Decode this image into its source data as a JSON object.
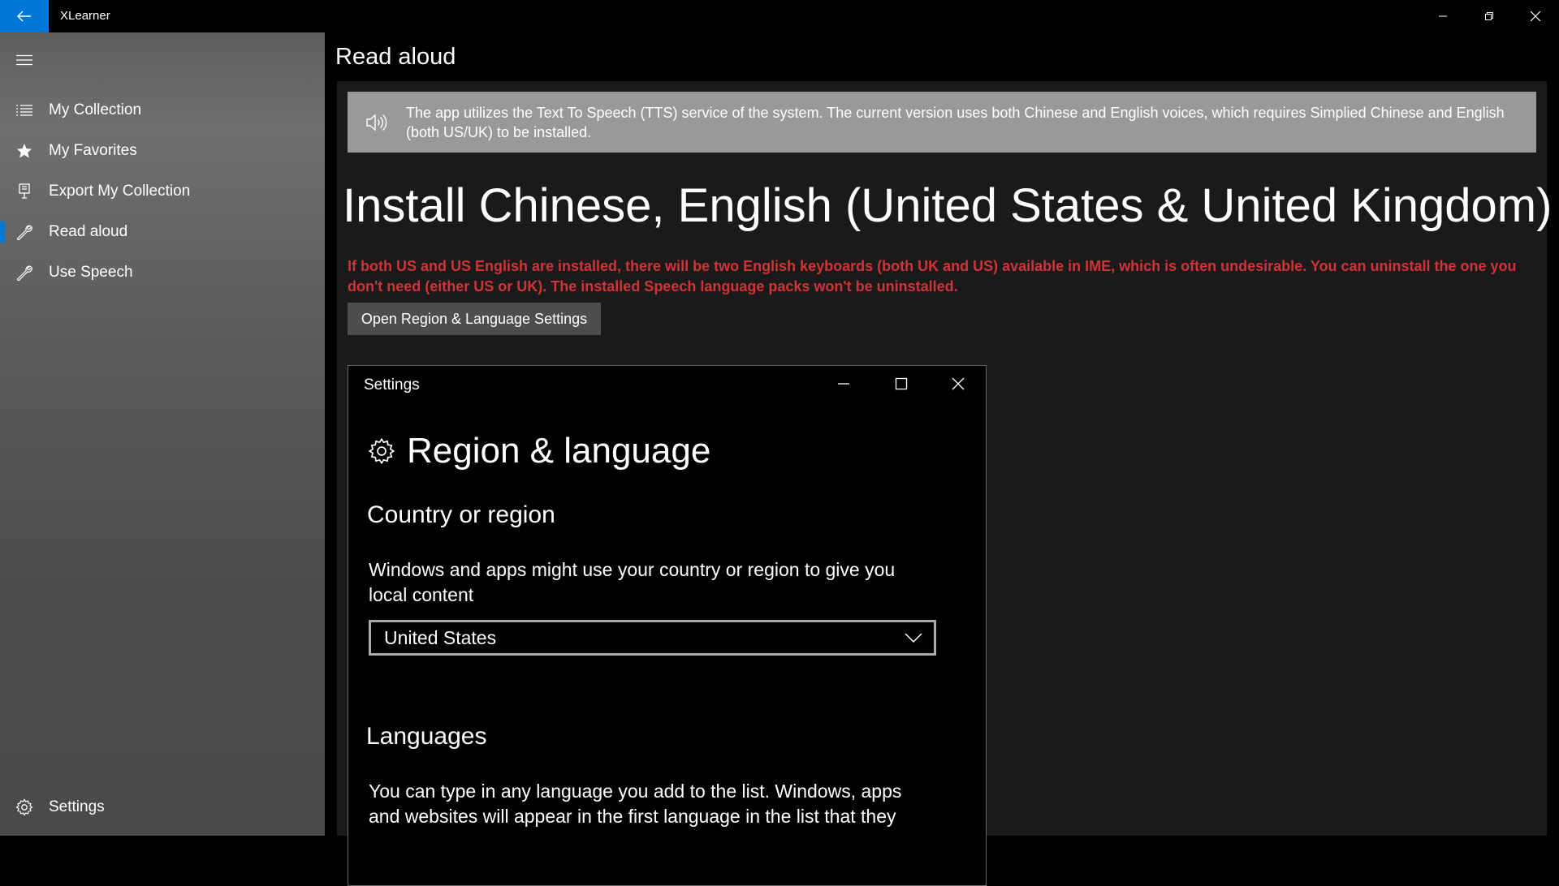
{
  "app": {
    "title": "XLearner"
  },
  "window_controls": {
    "minimize_icon": "minimize-icon",
    "restore_icon": "restore-icon",
    "close_icon": "close-icon"
  },
  "sidebar": {
    "items": [
      {
        "label": "My Collection",
        "icon": "list-icon"
      },
      {
        "label": "My Favorites",
        "icon": "star-icon"
      },
      {
        "label": "Export My Collection",
        "icon": "export-icon"
      },
      {
        "label": "Read aloud",
        "icon": "wrench-icon",
        "selected": true
      },
      {
        "label": "Use Speech",
        "icon": "wrench-icon"
      }
    ],
    "settings_label": "Settings"
  },
  "main": {
    "page_title": "Read aloud",
    "banner_text": "The app utilizes the Text To Speech (TTS) service of the system. The current version uses both Chinese and English voices, which requires Simplied Chinese and English (both US/UK) to be installed.",
    "heading": "Install Chinese, English (United States & United Kingdom)",
    "warning": "If both US and US English are installed, there will be two English keyboards (both UK and US) available in IME, which is often undesirable. You can uninstall the one you don't need (either US or UK). The installed Speech language packs won't be uninstalled.",
    "open_button": "Open Region & Language Settings"
  },
  "settings_screenshot": {
    "window_title": "Settings",
    "heading": "Region & language",
    "country_heading": "Country or region",
    "country_desc": "Windows and apps might use your country or region to give you local content",
    "country_value": "United States",
    "languages_heading": "Languages",
    "languages_desc": "You can type in any language you add to the list. Windows, apps and websites will appear in the first language in the list that they"
  },
  "colors": {
    "accent": "#0078d7",
    "warning": "#d13438",
    "banner": "#999999"
  }
}
